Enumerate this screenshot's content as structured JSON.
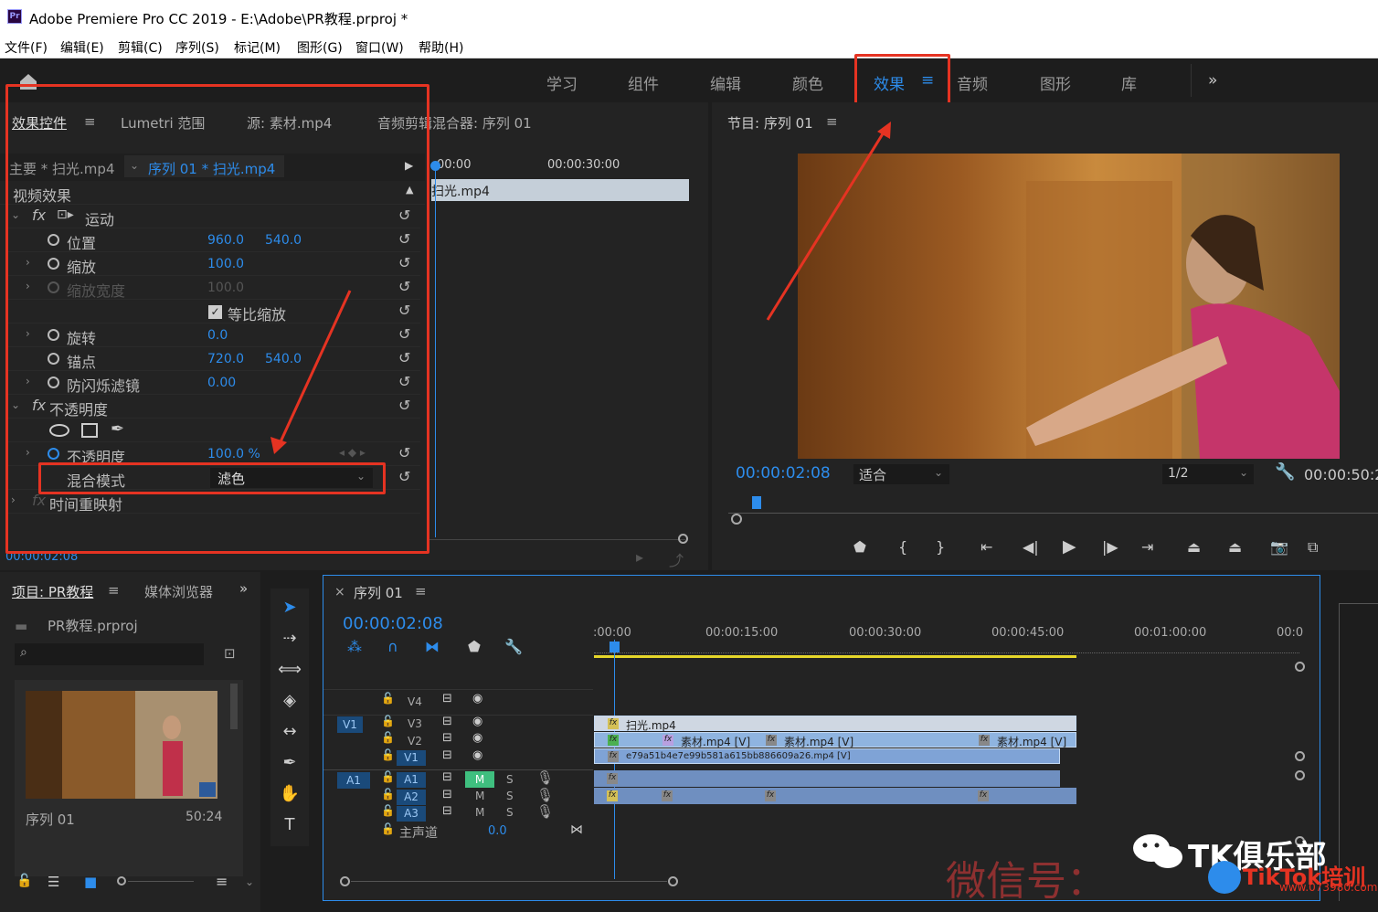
{
  "titlebar": {
    "app_icon": "Pr",
    "title": "Adobe Premiere Pro CC 2019 - E:\\Adobe\\PR教程.prproj *"
  },
  "menu": [
    "文件(F)",
    "编辑(E)",
    "剪辑(C)",
    "序列(S)",
    "标记(M)",
    "图形(G)",
    "窗口(W)",
    "帮助(H)"
  ],
  "workspaces": [
    "学习",
    "组件",
    "编辑",
    "颜色",
    "效果",
    "音频",
    "图形",
    "库"
  ],
  "workspace_more": "»",
  "effect_controls": {
    "tabs": [
      "效果控件",
      "Lumetri 范围",
      "源: 素材.mp4",
      "音频剪辑混合器: 序列 01"
    ],
    "master": "主要 * 扫光.mp4",
    "sequence": "序列 01 * 扫光.mp4",
    "ruler": [
      "00:00",
      "00:00:30:00"
    ],
    "clip": "扫光.mp4",
    "section": "视频效果",
    "motion": "运动",
    "position": {
      "label": "位置",
      "x": "960.0",
      "y": "540.0"
    },
    "scale": {
      "label": "缩放",
      "value": "100.0"
    },
    "scale_width": {
      "label": "缩放宽度",
      "value": "100.0"
    },
    "uniform": "等比缩放",
    "rotation": {
      "label": "旋转",
      "value": "0.0"
    },
    "anchor": {
      "label": "锚点",
      "x": "720.0",
      "y": "540.0"
    },
    "flicker": {
      "label": "防闪烁滤镜",
      "value": "0.00"
    },
    "opacity_group": "不透明度",
    "opacity": {
      "label": "不透明度",
      "value": "100.0 %"
    },
    "blend": {
      "label": "混合模式",
      "value": "滤色"
    },
    "time_remap": "时间重映射",
    "timecode": "00:00:02:08"
  },
  "program": {
    "title": "节目: 序列 01",
    "timecode": "00:00:02:08",
    "fit": "适合",
    "resolution": "1/2",
    "duration": "00:00:50:2"
  },
  "project": {
    "tabs": [
      "项目: PR教程",
      "媒体浏览器"
    ],
    "file": "PR教程.prproj",
    "item_name": "序列 01",
    "item_duration": "50:24"
  },
  "timeline": {
    "title": "序列 01",
    "timecode": "00:00:02:08",
    "ruler": [
      ":00:00",
      "00:00:15:00",
      "00:00:30:00",
      "00:00:45:00",
      "00:01:00:00",
      "00:0"
    ],
    "tracks_video": [
      "V4",
      "V3",
      "V2",
      "V1"
    ],
    "tracks_audio": [
      "A1",
      "A2",
      "A3"
    ],
    "source_v": "V1",
    "source_a": "A1",
    "master": "主声道",
    "master_value": "0.0",
    "clip_v3": "扫光.mp4",
    "clip_v2": [
      "素材.mp4 [V]",
      "素材.mp4 [V]",
      "素材.mp4 [V]"
    ],
    "clip_v1": "e79a51b4e7e99b581a615bb886609a26.mp4 [V]",
    "mute": "M",
    "solo": "S"
  },
  "watermark": {
    "text1": "微信号：",
    "text2": "TK俱乐部",
    "text3": "TikTok培训",
    "text4": "www.073980.com"
  },
  "colors": {
    "accent": "#2d8ceb",
    "highlight": "#e53322",
    "bg": "#1d1d1d"
  }
}
